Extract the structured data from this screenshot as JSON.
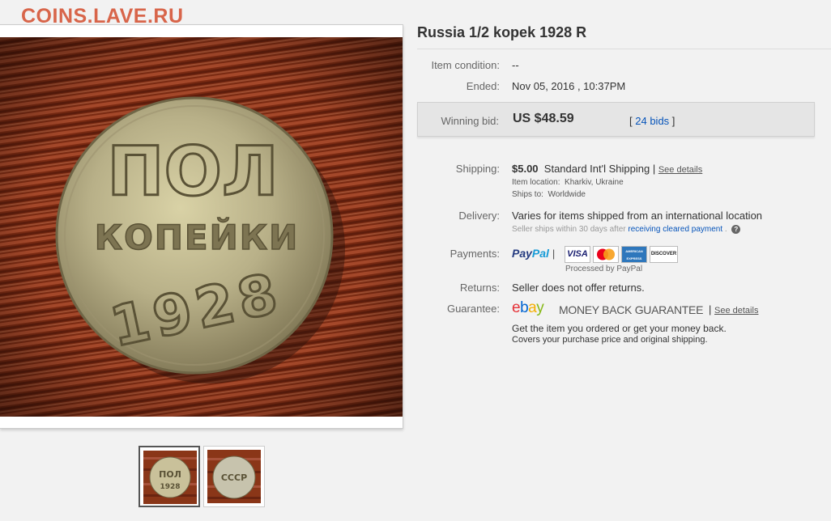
{
  "watermark": "COINS.LAVE.RU",
  "item": {
    "title": "Russia 1/2 kopek 1928 R"
  },
  "condition": {
    "label": "Item condition:",
    "value": "--"
  },
  "ended": {
    "label": "Ended:",
    "value": "Nov 05, 2016 , 10:37PM"
  },
  "bid": {
    "label": "Winning bid:",
    "price": "US $48.59",
    "bids_open": "[",
    "bids_link": "24 bids",
    "bids_close": "]"
  },
  "shipping": {
    "label": "Shipping:",
    "cost": "$5.00",
    "method": "Standard Int'l Shipping",
    "sep": "|",
    "see_details": "See details",
    "location_label": "Item location:",
    "location": "Kharkiv, Ukraine",
    "ships_to_label": "Ships to:",
    "ships_to": "Worldwide"
  },
  "delivery": {
    "label": "Delivery:",
    "text": "Varies for items shipped from an international location",
    "note": "Seller ships within 30 days after",
    "note_link": "receiving cleared payment",
    "note_end": ".",
    "help": "?"
  },
  "payments": {
    "label": "Payments:",
    "paypal_pay": "Pay",
    "paypal_pal": "Pal",
    "sep": "|",
    "cards": [
      "VISA",
      "MasterCard",
      "AMERICAN EXPRESS",
      "DISCOVER"
    ],
    "processed": "Processed by PayPal"
  },
  "returns": {
    "label": "Returns:",
    "value": "Seller does not offer returns."
  },
  "guarantee": {
    "label": "Guarantee:",
    "ebay_e": "e",
    "ebay_b": "b",
    "ebay_a": "a",
    "ebay_y": "y",
    "mbg": "MONEY BACK GUARANTEE",
    "sep": "|",
    "see_details": "See details",
    "line1": "Get the item you ordered or get your money back.",
    "line2": "Covers your purchase price and original shipping."
  },
  "coin_text": {
    "top": "ПОЛ",
    "middle": "КОПЕЙКИ",
    "year": "1928"
  },
  "reverse_text": "СССР",
  "colors": {
    "watermark": "#d8654a",
    "link": "#0654ba",
    "ebay_e": "#e53238",
    "ebay_b": "#0064d2",
    "ebay_a": "#f5af02",
    "ebay_y": "#86b817",
    "paypal_dark": "#253b80",
    "paypal_light": "#179bd7"
  }
}
